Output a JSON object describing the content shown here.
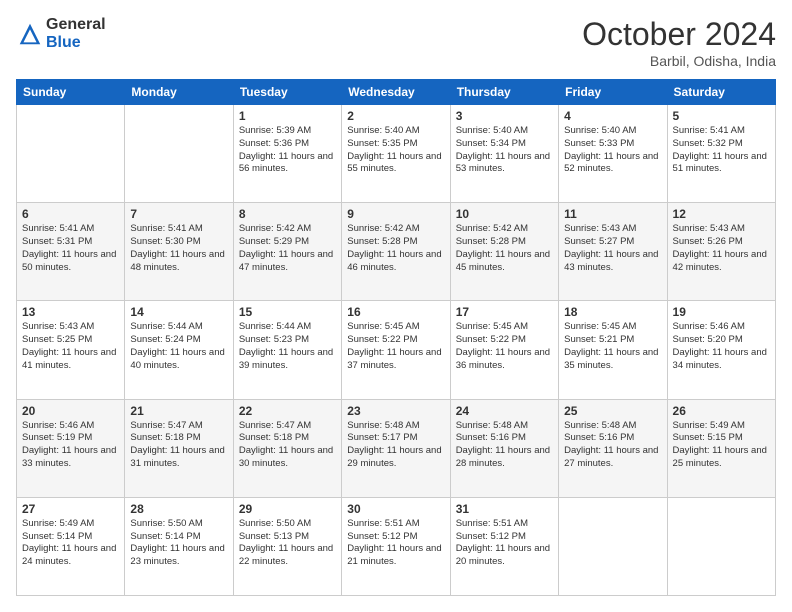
{
  "logo": {
    "general": "General",
    "blue": "Blue"
  },
  "header": {
    "month": "October 2024",
    "location": "Barbil, Odisha, India"
  },
  "weekdays": [
    "Sunday",
    "Monday",
    "Tuesday",
    "Wednesday",
    "Thursday",
    "Friday",
    "Saturday"
  ],
  "weeks": [
    [
      {
        "day": "",
        "info": ""
      },
      {
        "day": "",
        "info": ""
      },
      {
        "day": "1",
        "info": "Sunrise: 5:39 AM\nSunset: 5:36 PM\nDaylight: 11 hours and 56 minutes."
      },
      {
        "day": "2",
        "info": "Sunrise: 5:40 AM\nSunset: 5:35 PM\nDaylight: 11 hours and 55 minutes."
      },
      {
        "day": "3",
        "info": "Sunrise: 5:40 AM\nSunset: 5:34 PM\nDaylight: 11 hours and 53 minutes."
      },
      {
        "day": "4",
        "info": "Sunrise: 5:40 AM\nSunset: 5:33 PM\nDaylight: 11 hours and 52 minutes."
      },
      {
        "day": "5",
        "info": "Sunrise: 5:41 AM\nSunset: 5:32 PM\nDaylight: 11 hours and 51 minutes."
      }
    ],
    [
      {
        "day": "6",
        "info": "Sunrise: 5:41 AM\nSunset: 5:31 PM\nDaylight: 11 hours and 50 minutes."
      },
      {
        "day": "7",
        "info": "Sunrise: 5:41 AM\nSunset: 5:30 PM\nDaylight: 11 hours and 48 minutes."
      },
      {
        "day": "8",
        "info": "Sunrise: 5:42 AM\nSunset: 5:29 PM\nDaylight: 11 hours and 47 minutes."
      },
      {
        "day": "9",
        "info": "Sunrise: 5:42 AM\nSunset: 5:28 PM\nDaylight: 11 hours and 46 minutes."
      },
      {
        "day": "10",
        "info": "Sunrise: 5:42 AM\nSunset: 5:28 PM\nDaylight: 11 hours and 45 minutes."
      },
      {
        "day": "11",
        "info": "Sunrise: 5:43 AM\nSunset: 5:27 PM\nDaylight: 11 hours and 43 minutes."
      },
      {
        "day": "12",
        "info": "Sunrise: 5:43 AM\nSunset: 5:26 PM\nDaylight: 11 hours and 42 minutes."
      }
    ],
    [
      {
        "day": "13",
        "info": "Sunrise: 5:43 AM\nSunset: 5:25 PM\nDaylight: 11 hours and 41 minutes."
      },
      {
        "day": "14",
        "info": "Sunrise: 5:44 AM\nSunset: 5:24 PM\nDaylight: 11 hours and 40 minutes."
      },
      {
        "day": "15",
        "info": "Sunrise: 5:44 AM\nSunset: 5:23 PM\nDaylight: 11 hours and 39 minutes."
      },
      {
        "day": "16",
        "info": "Sunrise: 5:45 AM\nSunset: 5:22 PM\nDaylight: 11 hours and 37 minutes."
      },
      {
        "day": "17",
        "info": "Sunrise: 5:45 AM\nSunset: 5:22 PM\nDaylight: 11 hours and 36 minutes."
      },
      {
        "day": "18",
        "info": "Sunrise: 5:45 AM\nSunset: 5:21 PM\nDaylight: 11 hours and 35 minutes."
      },
      {
        "day": "19",
        "info": "Sunrise: 5:46 AM\nSunset: 5:20 PM\nDaylight: 11 hours and 34 minutes."
      }
    ],
    [
      {
        "day": "20",
        "info": "Sunrise: 5:46 AM\nSunset: 5:19 PM\nDaylight: 11 hours and 33 minutes."
      },
      {
        "day": "21",
        "info": "Sunrise: 5:47 AM\nSunset: 5:18 PM\nDaylight: 11 hours and 31 minutes."
      },
      {
        "day": "22",
        "info": "Sunrise: 5:47 AM\nSunset: 5:18 PM\nDaylight: 11 hours and 30 minutes."
      },
      {
        "day": "23",
        "info": "Sunrise: 5:48 AM\nSunset: 5:17 PM\nDaylight: 11 hours and 29 minutes."
      },
      {
        "day": "24",
        "info": "Sunrise: 5:48 AM\nSunset: 5:16 PM\nDaylight: 11 hours and 28 minutes."
      },
      {
        "day": "25",
        "info": "Sunrise: 5:48 AM\nSunset: 5:16 PM\nDaylight: 11 hours and 27 minutes."
      },
      {
        "day": "26",
        "info": "Sunrise: 5:49 AM\nSunset: 5:15 PM\nDaylight: 11 hours and 25 minutes."
      }
    ],
    [
      {
        "day": "27",
        "info": "Sunrise: 5:49 AM\nSunset: 5:14 PM\nDaylight: 11 hours and 24 minutes."
      },
      {
        "day": "28",
        "info": "Sunrise: 5:50 AM\nSunset: 5:14 PM\nDaylight: 11 hours and 23 minutes."
      },
      {
        "day": "29",
        "info": "Sunrise: 5:50 AM\nSunset: 5:13 PM\nDaylight: 11 hours and 22 minutes."
      },
      {
        "day": "30",
        "info": "Sunrise: 5:51 AM\nSunset: 5:12 PM\nDaylight: 11 hours and 21 minutes."
      },
      {
        "day": "31",
        "info": "Sunrise: 5:51 AM\nSunset: 5:12 PM\nDaylight: 11 hours and 20 minutes."
      },
      {
        "day": "",
        "info": ""
      },
      {
        "day": "",
        "info": ""
      }
    ]
  ]
}
